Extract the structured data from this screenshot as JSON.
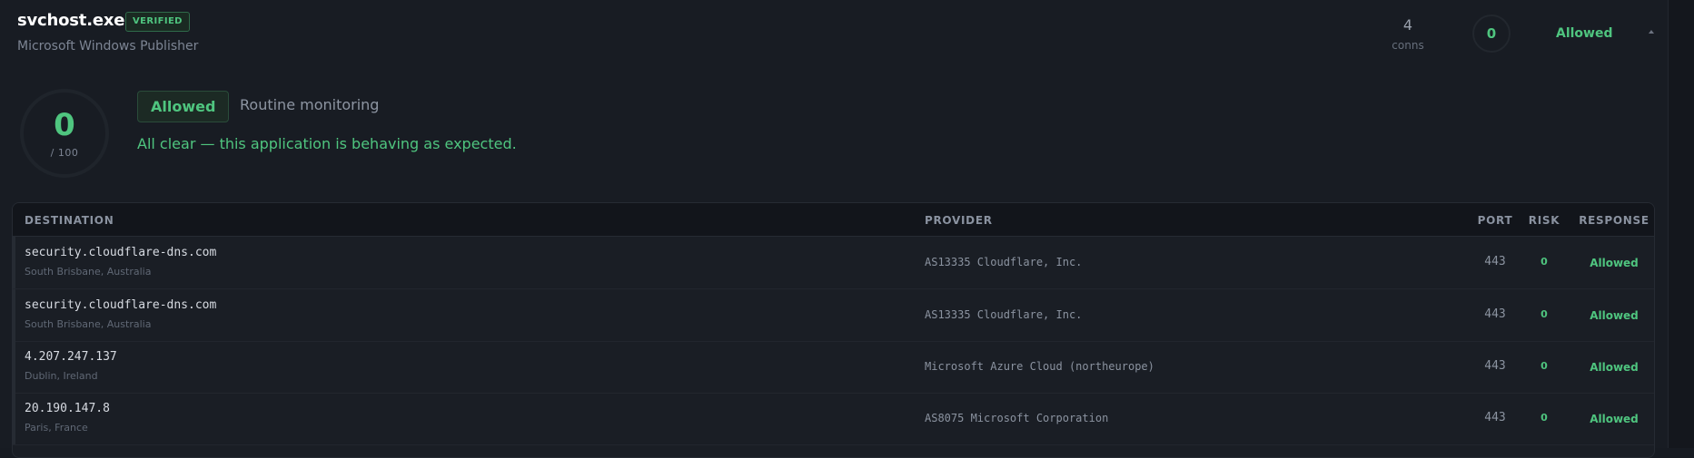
{
  "app": {
    "name": "svchost.exe",
    "badge": "VERIFIED",
    "publisher": "Microsoft Windows Publisher",
    "conns_count": "4",
    "conns_label": "conns",
    "score": "0",
    "status": "Allowed"
  },
  "summary": {
    "score": "0",
    "score_max": "/ 100",
    "status_pill": "Allowed",
    "reason": "Routine monitoring",
    "message": "All clear — this application is behaving as expected."
  },
  "table": {
    "headers": {
      "destination": "DESTINATION",
      "provider": "PROVIDER",
      "port": "PORT",
      "risk": "RISK",
      "response": "RESPONSE"
    },
    "rows": [
      {
        "destination": "security.cloudflare-dns.com",
        "location": "South Brisbane, Australia",
        "provider": "AS13335 Cloudflare, Inc.",
        "port": "443",
        "risk": "0",
        "response": "Allowed"
      },
      {
        "destination": "security.cloudflare-dns.com",
        "location": "South Brisbane, Australia",
        "provider": "AS13335 Cloudflare, Inc.",
        "port": "443",
        "risk": "0",
        "response": "Allowed"
      },
      {
        "destination": "4.207.247.137",
        "location": "Dublin, Ireland",
        "provider": "Microsoft Azure Cloud (northeurope)",
        "port": "443",
        "risk": "0",
        "response": "Allowed"
      },
      {
        "destination": "20.190.147.8",
        "location": "Paris, France",
        "provider": "AS8075 Microsoft Corporation",
        "port": "443",
        "risk": "0",
        "response": "Allowed"
      }
    ]
  },
  "colors": {
    "accent_green": "#4fc57f",
    "background": "#181c23"
  },
  "icons": {
    "collapse": "chevron-up-icon"
  }
}
